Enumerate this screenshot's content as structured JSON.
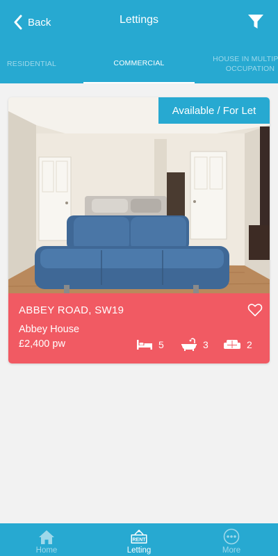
{
  "header": {
    "back_label": "Back",
    "title": "Lettings",
    "filter_icon": "filter-icon"
  },
  "tabs": [
    {
      "label": "RESIDENTIAL",
      "active": false
    },
    {
      "label": "COMMERCIAL",
      "active": true
    },
    {
      "label": "HOUSE IN MULTIPLE OCCUPATION",
      "active": false
    }
  ],
  "listing": {
    "status": "Available / For Let",
    "address": "ABBEY ROAD, SW19",
    "name": "Abbey House",
    "price": "£2,400 pw",
    "bedrooms": "5",
    "bathrooms": "3",
    "receptions": "2",
    "favorite": false
  },
  "bottom_nav": [
    {
      "label": "Home",
      "icon": "home-icon",
      "active": false
    },
    {
      "label": "Letting",
      "icon": "rent-sign-icon",
      "badge": "RENT",
      "active": true
    },
    {
      "label": "More",
      "icon": "more-icon",
      "active": false
    }
  ],
  "colors": {
    "primary": "#27a9d1",
    "card_info": "#f15a63",
    "background": "#f2f2f2"
  }
}
